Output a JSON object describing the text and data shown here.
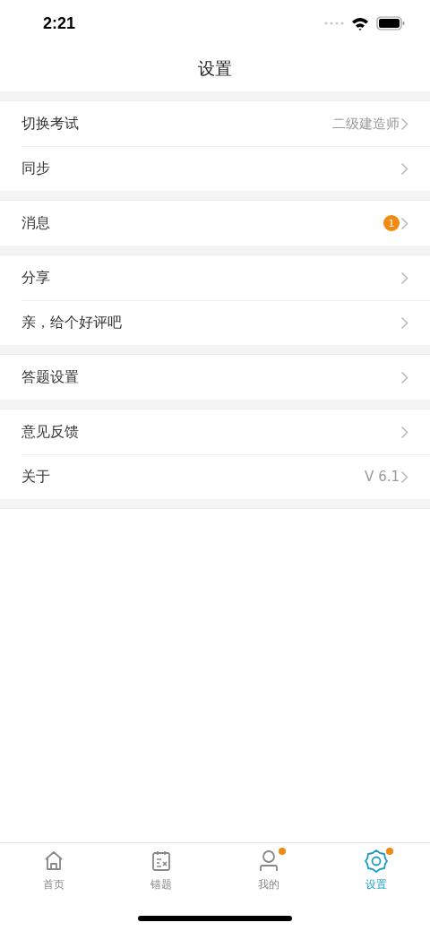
{
  "status_bar": {
    "time": "2:21"
  },
  "nav": {
    "title": "设置"
  },
  "groups": [
    {
      "rows": [
        {
          "label": "切换考试",
          "value": "二级建造师"
        },
        {
          "label": "同步"
        }
      ]
    },
    {
      "rows": [
        {
          "label": "消息",
          "badge": "1"
        }
      ]
    },
    {
      "rows": [
        {
          "label": "分享"
        },
        {
          "label": "亲，给个好评吧"
        }
      ]
    },
    {
      "rows": [
        {
          "label": "答题设置"
        }
      ]
    },
    {
      "rows": [
        {
          "label": "意见反馈"
        },
        {
          "label": "关于",
          "value": "V 6.1"
        }
      ]
    }
  ],
  "tab_bar": [
    {
      "label": "首页",
      "selected": false,
      "dot": false
    },
    {
      "label": "错题",
      "selected": false,
      "dot": false
    },
    {
      "label": "我的",
      "selected": false,
      "dot": true
    },
    {
      "label": "设置",
      "selected": true,
      "dot": true
    }
  ]
}
